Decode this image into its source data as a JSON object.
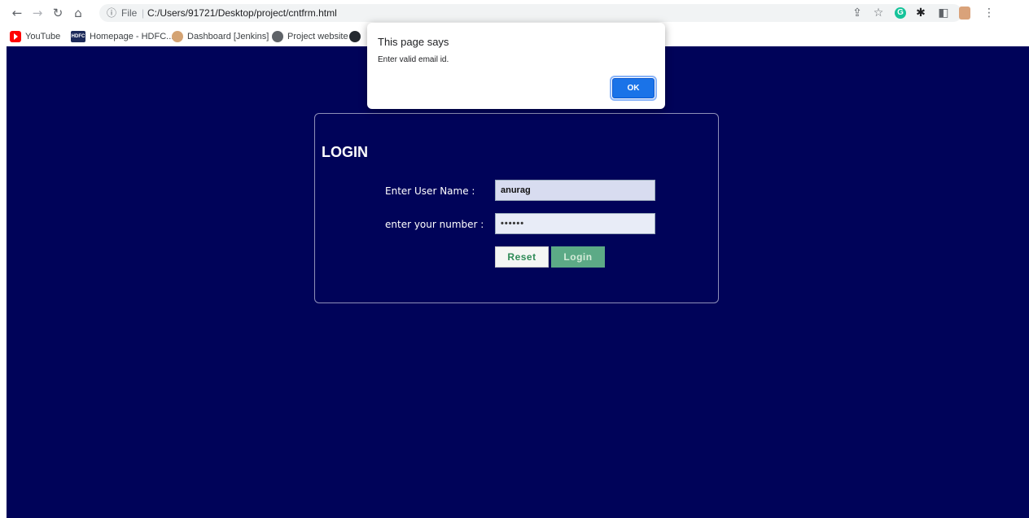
{
  "browser": {
    "url_scheme": "File",
    "url": "C:/Users/91721/Desktop/project/cntfrm.html",
    "grammarly_letter": "G"
  },
  "bookmarks": [
    {
      "label": "YouTube"
    },
    {
      "label": "Homepage - HDFC...",
      "icon_text": "HDFC"
    },
    {
      "label": "Dashboard [Jenkins]"
    },
    {
      "label": "Project website"
    }
  ],
  "dialog": {
    "title": "This page says",
    "message": "Enter valid email id.",
    "ok_label": "OK"
  },
  "login": {
    "title": "LOGIN",
    "username_label": "Enter User Name :",
    "username_value": "anurag",
    "number_label": "enter your number :",
    "number_value": "••••••",
    "reset_label": "Reset",
    "login_label": "Login"
  },
  "colors": {
    "page_bg": "#000359",
    "dialog_ok": "#1a73e8",
    "login_btn": "#5caa86",
    "reset_text": "#2e8b57"
  }
}
